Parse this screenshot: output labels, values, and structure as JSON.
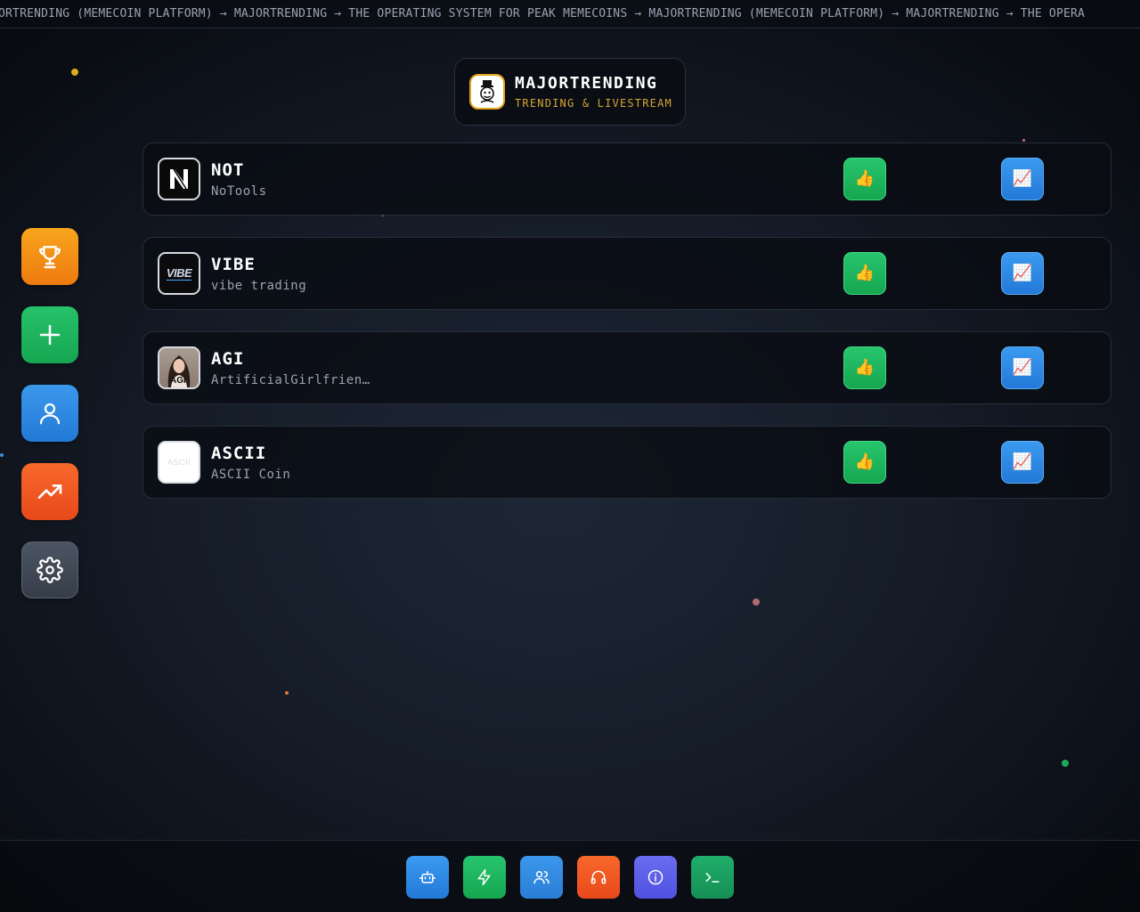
{
  "ticker": {
    "text": "ORTRENDING (MEMECOIN PLATFORM) → MAJORTRENDING → THE OPERATING SYSTEM FOR PEAK MEMECOINS → MAJORTRENDING (MEMECOIN PLATFORM) → MAJORTRENDING → THE OPERA"
  },
  "brand": {
    "title": "MAJORTRENDING",
    "subtitle": "TRENDING & LIVESTREAM"
  },
  "sidebar": {
    "items": [
      {
        "icon": "trophy-icon"
      },
      {
        "icon": "plus-icon"
      },
      {
        "icon": "user-icon"
      },
      {
        "icon": "trending-up-icon"
      },
      {
        "icon": "gear-icon"
      }
    ]
  },
  "coins": [
    {
      "name": "NOT",
      "description": "NoTools",
      "logo_icon": "notools-logo-icon"
    },
    {
      "name": "VIBE",
      "description": "vibe trading",
      "logo_icon": "vibe-logo-icon",
      "logo_text": "VIBE"
    },
    {
      "name": "AGI",
      "description": "ArtificialGirlfrien…",
      "logo_icon": "agi-avatar-icon",
      "logo_text": "AGI"
    },
    {
      "name": "ASCII",
      "description": "ASCII Coin",
      "logo_icon": "ascii-logo-icon",
      "logo_text": "ASCII"
    }
  ],
  "bottombar": {
    "items": [
      {
        "icon": "robot-icon"
      },
      {
        "icon": "lightning-icon"
      },
      {
        "icon": "users-icon"
      },
      {
        "icon": "headphones-icon"
      },
      {
        "icon": "info-icon"
      },
      {
        "icon": "terminal-icon"
      }
    ]
  },
  "colors": {
    "accent_gold": "#d4a533",
    "green": "#1fb85f",
    "blue": "#2f89e2",
    "orange": "#f07a16",
    "red_orange": "#f0561f",
    "gray": "#3f4753",
    "indigo": "#5c5fe8"
  }
}
